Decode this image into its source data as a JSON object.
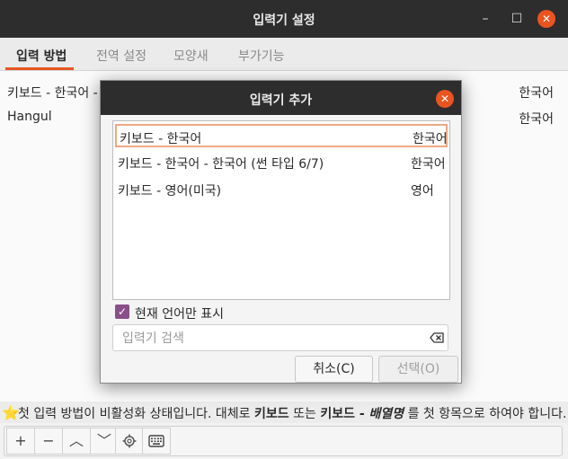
{
  "window": {
    "title": "입력기 설정"
  },
  "tabs": [
    "입력 방법",
    "전역 설정",
    "모양새",
    "부가기능"
  ],
  "methods": [
    {
      "name": "키보드 - 한국어 - 한",
      "lang": "한국어"
    },
    {
      "name": "Hangul",
      "lang": "한국어"
    }
  ],
  "info": {
    "star": "⭐",
    "prefix": "첫 입력 방법이 비활성화 상태입니다. 대체로 ",
    "bold1": "키보드",
    "mid": " 또는 ",
    "bold2": "키보드 - ",
    "ital": "배열명",
    "suffix": " 를 첫 항목으로 하여야 합니다."
  },
  "toolbar": {
    "add": "+",
    "remove": "−",
    "up": "︿",
    "down": "﹀",
    "configure_icon": "gear-icon",
    "keyboard_icon": "keyboard-icon"
  },
  "dialog": {
    "title": "입력기 추가",
    "items": [
      {
        "name": "키보드 - 한국어",
        "lang": "한국어",
        "selected": true
      },
      {
        "name": "키보드 - 한국어 - 한국어 (썬 타입 6/7)",
        "lang": "한국어",
        "selected": false
      },
      {
        "name": "키보드 - 영어(미국)",
        "lang": "영어",
        "selected": false
      }
    ],
    "only_current_label": "현재 언어만 표시",
    "only_current_checked": true,
    "search_placeholder": "입력기 검색",
    "search_value": "",
    "cancel_label": "취소(C)",
    "ok_label": "선택(O)"
  },
  "colors": {
    "accent": "#e95420",
    "checkbox": "#8a4f8a",
    "selection_border": "#f0a884"
  }
}
